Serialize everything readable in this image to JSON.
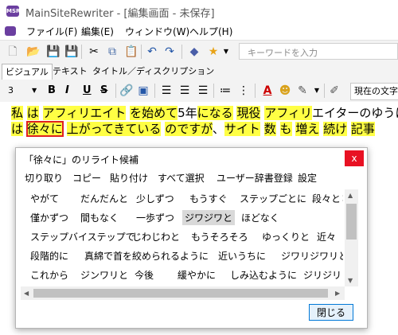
{
  "window": {
    "title": "MainSiteRewriter - [編集画面 - 未保存]",
    "icon_text": "MSR"
  },
  "menubar": {
    "items": [
      "ファイル(F)",
      "編集(E)",
      "ウィンドウ(W)",
      "ヘルプ(H)"
    ]
  },
  "toolbar": {
    "icons": [
      "new-file-icon",
      "open-folder-icon",
      "save-icon",
      "save-all-icon",
      "cut-icon",
      "copy-icon",
      "paste-icon",
      "undo-icon",
      "redo-icon",
      "book-icon",
      "star-icon"
    ],
    "search_placeholder": "キーワードを入力"
  },
  "tabs": {
    "items": [
      "ビジュアル",
      "テキスト",
      "タイトル／ディスクリプション"
    ],
    "active": 0
  },
  "format_toolbar": {
    "font_size": "3",
    "buttons": [
      "B",
      "I",
      "U",
      "S"
    ],
    "current_text_label": "現在の文字"
  },
  "editor": {
    "line1": [
      {
        "t": "私",
        "hl": true
      },
      {
        "t": " ",
        "hl": false
      },
      {
        "t": "は",
        "hl": true
      },
      {
        "t": " ",
        "hl": false
      },
      {
        "t": "アフィリエイト",
        "hl": true
      },
      {
        "t": " ",
        "hl": false
      },
      {
        "t": "を",
        "hl": true
      },
      {
        "t": "始めて",
        "hl": true
      },
      {
        "t": "5年",
        "hl": false
      },
      {
        "t": "に",
        "hl": true
      },
      {
        "t": "なる",
        "hl": true
      },
      {
        "t": " ",
        "hl": false
      },
      {
        "t": "現役",
        "hl": true
      },
      {
        "t": " ",
        "hl": false
      },
      {
        "t": "アフィリ",
        "hl": true
      },
      {
        "t": "エイターのゆうに",
        "hl": false
      }
    ],
    "line2": [
      {
        "t": "は",
        "hl": true
      },
      {
        "t": " ",
        "hl": false
      },
      {
        "t": "徐々に",
        "hl": true,
        "sel": true
      },
      {
        "t": " ",
        "hl": false
      },
      {
        "t": "上がってきている",
        "hl": true
      },
      {
        "t": " ",
        "hl": false
      },
      {
        "t": "のですが",
        "hl": true
      },
      {
        "t": "、",
        "hl": false
      },
      {
        "t": "サイト",
        "hl": true
      },
      {
        "t": " ",
        "hl": false
      },
      {
        "t": "数",
        "hl": true
      },
      {
        "t": " ",
        "hl": false
      },
      {
        "t": "も",
        "hl": true
      },
      {
        "t": " ",
        "hl": false
      },
      {
        "t": "増え",
        "hl": true
      },
      {
        "t": " ",
        "hl": false
      },
      {
        "t": "続け",
        "hl": true
      },
      {
        "t": " ",
        "hl": false
      },
      {
        "t": "記事",
        "hl": true
      }
    ]
  },
  "dialog": {
    "title": "「徐々に」のリライト候補",
    "close_glyph": "x",
    "menu": [
      "切り取り",
      "コピー",
      "貼り付け",
      "すべて選択",
      "ユーザー辞書登録",
      "設定"
    ],
    "candidates": [
      [
        "やがて",
        "だんだんと",
        "少しずつ",
        "もうすぐ",
        "ステップごとに",
        "段々と",
        "将来"
      ],
      [
        "僅かずつ",
        "間もなく",
        "一歩ずつ",
        "ジワジワと",
        "ほどなく"
      ],
      [
        "ステップバイステップで",
        "じわじわと",
        "もうそろそろ",
        "ゆっくりと",
        "近々"
      ],
      [
        "段階的に",
        "真綿で首を絞められるように",
        "近いうちに",
        "ジワリジワリと"
      ],
      [
        "これから",
        "ジンワリと",
        "今後",
        "緩やかに",
        "しみ込むように",
        "ジリジリと"
      ]
    ],
    "selected_candidate": "ジワジワと",
    "close_button": "閉じる"
  }
}
